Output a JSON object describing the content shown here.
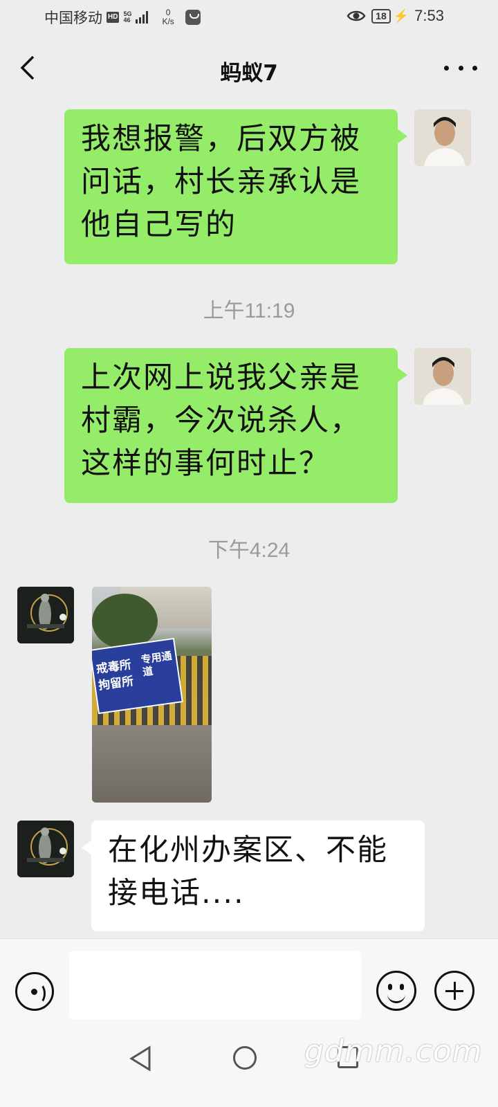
{
  "status_bar": {
    "carrier": "中国移动",
    "hd_badge": "HD",
    "network_type": "5G",
    "network_sub": "46",
    "speed_value": "0",
    "speed_unit": "K/s",
    "battery": "18",
    "time": "7:53"
  },
  "header": {
    "title": "蚂蚁7"
  },
  "messages": [
    {
      "sender": "me",
      "type": "text",
      "text": "我想报警，后双方被问话，村长亲承认是他自己写的"
    },
    {
      "type": "timestamp",
      "text": "上午11:19"
    },
    {
      "sender": "me",
      "type": "text",
      "text": "上次网上说我父亲是村霸，今次说杀人，这样的事何时止？"
    },
    {
      "type": "timestamp",
      "text": "下午4:24"
    },
    {
      "sender": "other",
      "type": "image",
      "sign_line1": "戒毒所",
      "sign_line2": "拘留所",
      "sign_side": "专用通道"
    },
    {
      "sender": "other",
      "type": "text",
      "text": "在化州办案区、不能接电话...."
    }
  ],
  "input_bar": {
    "placeholder": ""
  },
  "watermark": "gdmm.com",
  "icons": {
    "back": "chevron-left-icon",
    "more": "ellipsis-icon",
    "voice": "voice-icon",
    "emoji": "emoji-icon",
    "plus": "plus-icon"
  },
  "colors": {
    "background": "#ededed",
    "my_bubble": "#95ec69",
    "other_bubble": "#ffffff"
  }
}
